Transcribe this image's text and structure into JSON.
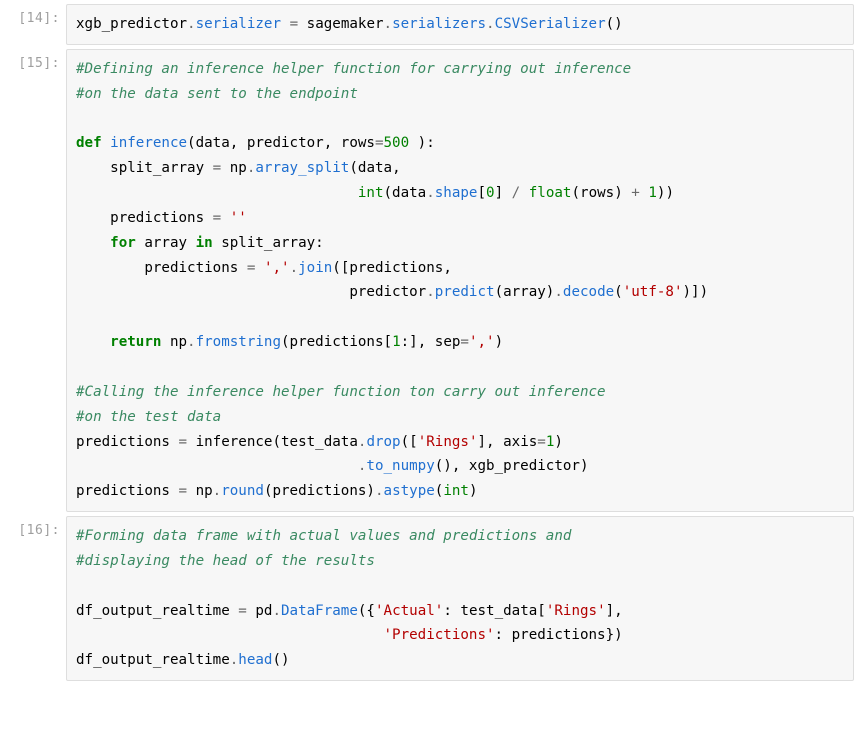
{
  "cells": [
    {
      "prompt": "[14]:",
      "tokens": [
        {
          "t": "xgb_predictor",
          "c": ""
        },
        {
          "t": ".",
          "c": "c-op"
        },
        {
          "t": "serializer",
          "c": "c-fn"
        },
        {
          "t": " ",
          "c": ""
        },
        {
          "t": "=",
          "c": "c-op"
        },
        {
          "t": " sagemaker",
          "c": ""
        },
        {
          "t": ".",
          "c": "c-op"
        },
        {
          "t": "serializers",
          "c": "c-fn"
        },
        {
          "t": ".",
          "c": "c-op"
        },
        {
          "t": "CSVSerializer",
          "c": "c-fn"
        },
        {
          "t": "()",
          "c": ""
        }
      ]
    },
    {
      "prompt": "[15]:",
      "tokens": [
        {
          "t": "#Defining an inference helper function for carrying out inference",
          "c": "c-cmt"
        },
        {
          "t": "\n",
          "c": ""
        },
        {
          "t": "#on the data sent to the endpoint",
          "c": "c-cmt"
        },
        {
          "t": "\n\n",
          "c": ""
        },
        {
          "t": "def",
          "c": "c-kw"
        },
        {
          "t": " ",
          "c": ""
        },
        {
          "t": "inference",
          "c": "c-fn"
        },
        {
          "t": "(data, predictor, rows",
          "c": ""
        },
        {
          "t": "=",
          "c": "c-op"
        },
        {
          "t": "500",
          "c": "c-num"
        },
        {
          "t": " ):",
          "c": ""
        },
        {
          "t": "\n",
          "c": ""
        },
        {
          "t": "    split_array ",
          "c": ""
        },
        {
          "t": "=",
          "c": "c-op"
        },
        {
          "t": " np",
          "c": ""
        },
        {
          "t": ".",
          "c": "c-op"
        },
        {
          "t": "array_split",
          "c": "c-fn"
        },
        {
          "t": "(data,",
          "c": ""
        },
        {
          "t": "\n",
          "c": ""
        },
        {
          "t": "                                 ",
          "c": ""
        },
        {
          "t": "int",
          "c": "c-num"
        },
        {
          "t": "(data",
          "c": ""
        },
        {
          "t": ".",
          "c": "c-op"
        },
        {
          "t": "shape",
          "c": "c-fn"
        },
        {
          "t": "[",
          "c": ""
        },
        {
          "t": "0",
          "c": "c-num"
        },
        {
          "t": "] ",
          "c": ""
        },
        {
          "t": "/",
          "c": "c-op"
        },
        {
          "t": " ",
          "c": ""
        },
        {
          "t": "float",
          "c": "c-num"
        },
        {
          "t": "(rows) ",
          "c": ""
        },
        {
          "t": "+",
          "c": "c-op"
        },
        {
          "t": " ",
          "c": ""
        },
        {
          "t": "1",
          "c": "c-num"
        },
        {
          "t": "))",
          "c": ""
        },
        {
          "t": "\n",
          "c": ""
        },
        {
          "t": "    predictions ",
          "c": ""
        },
        {
          "t": "=",
          "c": "c-op"
        },
        {
          "t": " ",
          "c": ""
        },
        {
          "t": "''",
          "c": "c-str"
        },
        {
          "t": "\n",
          "c": ""
        },
        {
          "t": "    ",
          "c": ""
        },
        {
          "t": "for",
          "c": "c-kw"
        },
        {
          "t": " array ",
          "c": ""
        },
        {
          "t": "in",
          "c": "c-kw"
        },
        {
          "t": " split_array:",
          "c": ""
        },
        {
          "t": "\n",
          "c": ""
        },
        {
          "t": "        predictions ",
          "c": ""
        },
        {
          "t": "=",
          "c": "c-op"
        },
        {
          "t": " ",
          "c": ""
        },
        {
          "t": "','",
          "c": "c-str"
        },
        {
          "t": ".",
          "c": "c-op"
        },
        {
          "t": "join",
          "c": "c-fn"
        },
        {
          "t": "([predictions,",
          "c": ""
        },
        {
          "t": "\n",
          "c": ""
        },
        {
          "t": "                                predictor",
          "c": ""
        },
        {
          "t": ".",
          "c": "c-op"
        },
        {
          "t": "predict",
          "c": "c-fn"
        },
        {
          "t": "(array)",
          "c": ""
        },
        {
          "t": ".",
          "c": "c-op"
        },
        {
          "t": "decode",
          "c": "c-fn"
        },
        {
          "t": "(",
          "c": ""
        },
        {
          "t": "'utf-8'",
          "c": "c-str"
        },
        {
          "t": ")])",
          "c": ""
        },
        {
          "t": "\n\n",
          "c": ""
        },
        {
          "t": "    ",
          "c": ""
        },
        {
          "t": "return",
          "c": "c-kw"
        },
        {
          "t": " np",
          "c": ""
        },
        {
          "t": ".",
          "c": "c-op"
        },
        {
          "t": "fromstring",
          "c": "c-fn"
        },
        {
          "t": "(predictions[",
          "c": ""
        },
        {
          "t": "1",
          "c": "c-num"
        },
        {
          "t": ":], sep",
          "c": ""
        },
        {
          "t": "=",
          "c": "c-op"
        },
        {
          "t": "','",
          "c": "c-str"
        },
        {
          "t": ")",
          "c": ""
        },
        {
          "t": "\n\n",
          "c": ""
        },
        {
          "t": "#Calling the inference helper function ton carry out inference",
          "c": "c-cmt"
        },
        {
          "t": "\n",
          "c": ""
        },
        {
          "t": "#on the test data",
          "c": "c-cmt"
        },
        {
          "t": "\n",
          "c": ""
        },
        {
          "t": "predictions ",
          "c": ""
        },
        {
          "t": "=",
          "c": "c-op"
        },
        {
          "t": " inference(test_data",
          "c": ""
        },
        {
          "t": ".",
          "c": "c-op"
        },
        {
          "t": "drop",
          "c": "c-fn"
        },
        {
          "t": "([",
          "c": ""
        },
        {
          "t": "'Rings'",
          "c": "c-str"
        },
        {
          "t": "], axis",
          "c": ""
        },
        {
          "t": "=",
          "c": "c-op"
        },
        {
          "t": "1",
          "c": "c-num"
        },
        {
          "t": ")",
          "c": ""
        },
        {
          "t": "\n",
          "c": ""
        },
        {
          "t": "                                 ",
          "c": ""
        },
        {
          "t": ".",
          "c": "c-op"
        },
        {
          "t": "to_numpy",
          "c": "c-fn"
        },
        {
          "t": "(), xgb_predictor)",
          "c": ""
        },
        {
          "t": "\n",
          "c": ""
        },
        {
          "t": "predictions ",
          "c": ""
        },
        {
          "t": "=",
          "c": "c-op"
        },
        {
          "t": " np",
          "c": ""
        },
        {
          "t": ".",
          "c": "c-op"
        },
        {
          "t": "round",
          "c": "c-fn"
        },
        {
          "t": "(predictions)",
          "c": ""
        },
        {
          "t": ".",
          "c": "c-op"
        },
        {
          "t": "astype",
          "c": "c-fn"
        },
        {
          "t": "(",
          "c": ""
        },
        {
          "t": "int",
          "c": "c-num"
        },
        {
          "t": ")",
          "c": ""
        }
      ]
    },
    {
      "prompt": "[16]:",
      "tokens": [
        {
          "t": "#Forming data frame with actual values and predictions and",
          "c": "c-cmt"
        },
        {
          "t": "\n",
          "c": ""
        },
        {
          "t": "#displaying the head of the results",
          "c": "c-cmt"
        },
        {
          "t": "\n\n",
          "c": ""
        },
        {
          "t": "df_output_realtime ",
          "c": ""
        },
        {
          "t": "=",
          "c": "c-op"
        },
        {
          "t": " pd",
          "c": ""
        },
        {
          "t": ".",
          "c": "c-op"
        },
        {
          "t": "DataFrame",
          "c": "c-fn"
        },
        {
          "t": "({",
          "c": ""
        },
        {
          "t": "'Actual'",
          "c": "c-str"
        },
        {
          "t": ": test_data[",
          "c": ""
        },
        {
          "t": "'Rings'",
          "c": "c-str"
        },
        {
          "t": "],",
          "c": ""
        },
        {
          "t": "\n",
          "c": ""
        },
        {
          "t": "                                    ",
          "c": ""
        },
        {
          "t": "'Predictions'",
          "c": "c-str"
        },
        {
          "t": ": predictions})",
          "c": ""
        },
        {
          "t": "\n",
          "c": ""
        },
        {
          "t": "df_output_realtime",
          "c": ""
        },
        {
          "t": ".",
          "c": "c-op"
        },
        {
          "t": "head",
          "c": "c-fn"
        },
        {
          "t": "()",
          "c": ""
        }
      ]
    }
  ]
}
